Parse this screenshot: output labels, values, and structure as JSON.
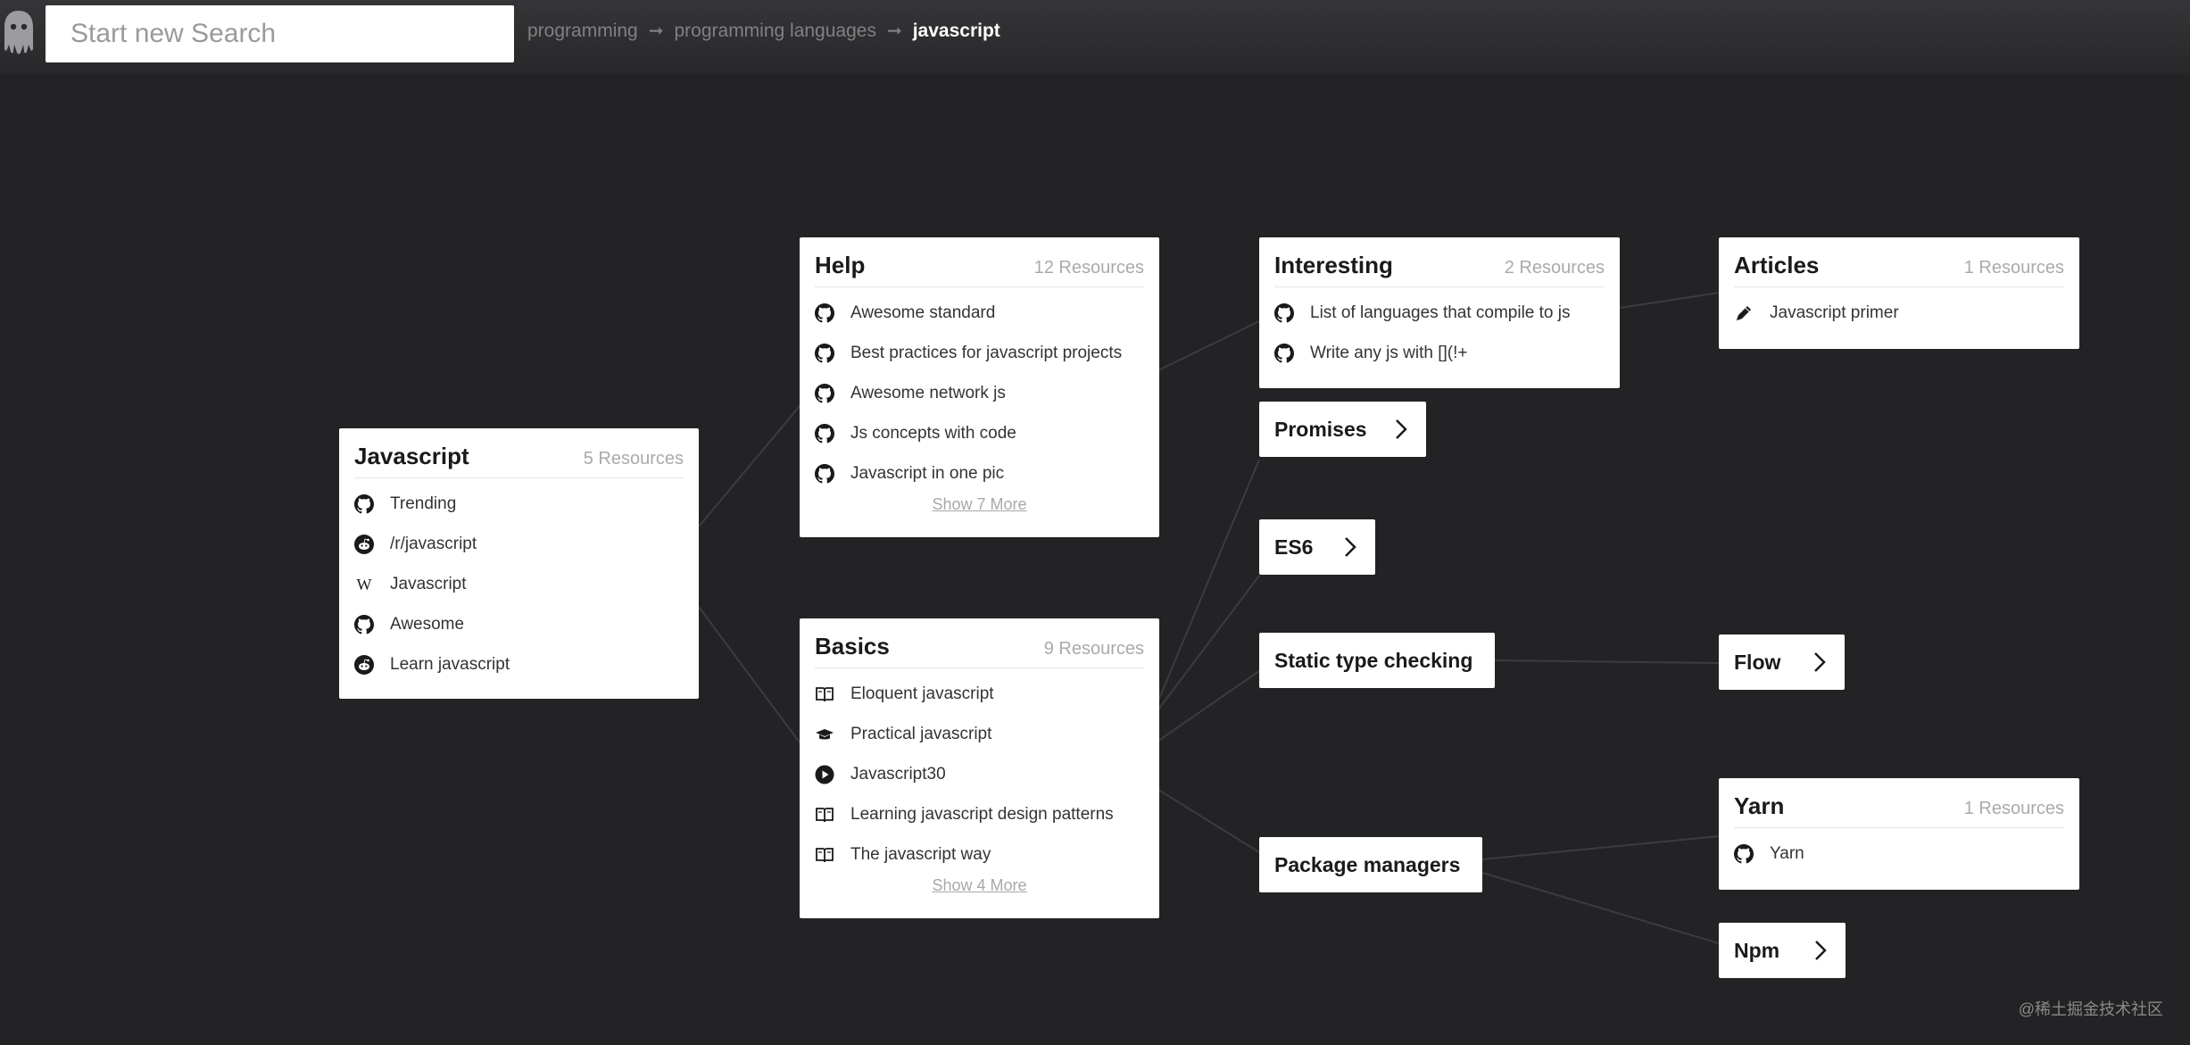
{
  "search": {
    "placeholder": "Start new Search"
  },
  "breadcrumb": [
    "programming",
    "programming languages",
    "javascript"
  ],
  "breadcrumb_sep": "➞",
  "cards": {
    "javascript": {
      "title": "Javascript",
      "count": "5 Resources",
      "items": [
        {
          "icon": "github-icon",
          "label": "Trending"
        },
        {
          "icon": "reddit-icon",
          "label": "/r/javascript"
        },
        {
          "icon": "wikipedia-icon",
          "label": "Javascript"
        },
        {
          "icon": "github-icon",
          "label": "Awesome"
        },
        {
          "icon": "reddit-icon",
          "label": "Learn javascript"
        }
      ]
    },
    "help": {
      "title": "Help",
      "count": "12 Resources",
      "more": "Show 7 More",
      "items": [
        {
          "icon": "github-icon",
          "label": "Awesome standard"
        },
        {
          "icon": "github-icon",
          "label": "Best practices for javascript projects"
        },
        {
          "icon": "github-icon",
          "label": "Awesome network js"
        },
        {
          "icon": "github-icon",
          "label": "Js concepts with code"
        },
        {
          "icon": "github-icon",
          "label": "Javascript in one pic"
        }
      ]
    },
    "basics": {
      "title": "Basics",
      "count": "9 Resources",
      "more": "Show 4 More",
      "items": [
        {
          "icon": "book-icon",
          "label": "Eloquent javascript"
        },
        {
          "icon": "graduation-cap-icon",
          "label": "Practical javascript"
        },
        {
          "icon": "play-icon",
          "label": "Javascript30"
        },
        {
          "icon": "book-icon",
          "label": "Learning javascript design patterns"
        },
        {
          "icon": "book-icon",
          "label": "The javascript way"
        }
      ]
    },
    "interesting": {
      "title": "Interesting",
      "count": "2 Resources",
      "items": [
        {
          "icon": "github-icon",
          "label": "List of languages that compile to js"
        },
        {
          "icon": "github-icon",
          "label": "Write any js with [](!+"
        }
      ]
    },
    "articles": {
      "title": "Articles",
      "count": "1 Resources",
      "items": [
        {
          "icon": "pen-icon",
          "label": "Javascript primer"
        }
      ]
    },
    "yarn": {
      "title": "Yarn",
      "count": "1 Resources",
      "items": [
        {
          "icon": "github-icon",
          "label": "Yarn"
        }
      ]
    }
  },
  "pills": {
    "promises": "Promises",
    "es6": "ES6",
    "static": "Static type checking",
    "flow": "Flow",
    "package": "Package managers",
    "npm": "Npm"
  },
  "watermark": "@稀土掘金技术社区"
}
